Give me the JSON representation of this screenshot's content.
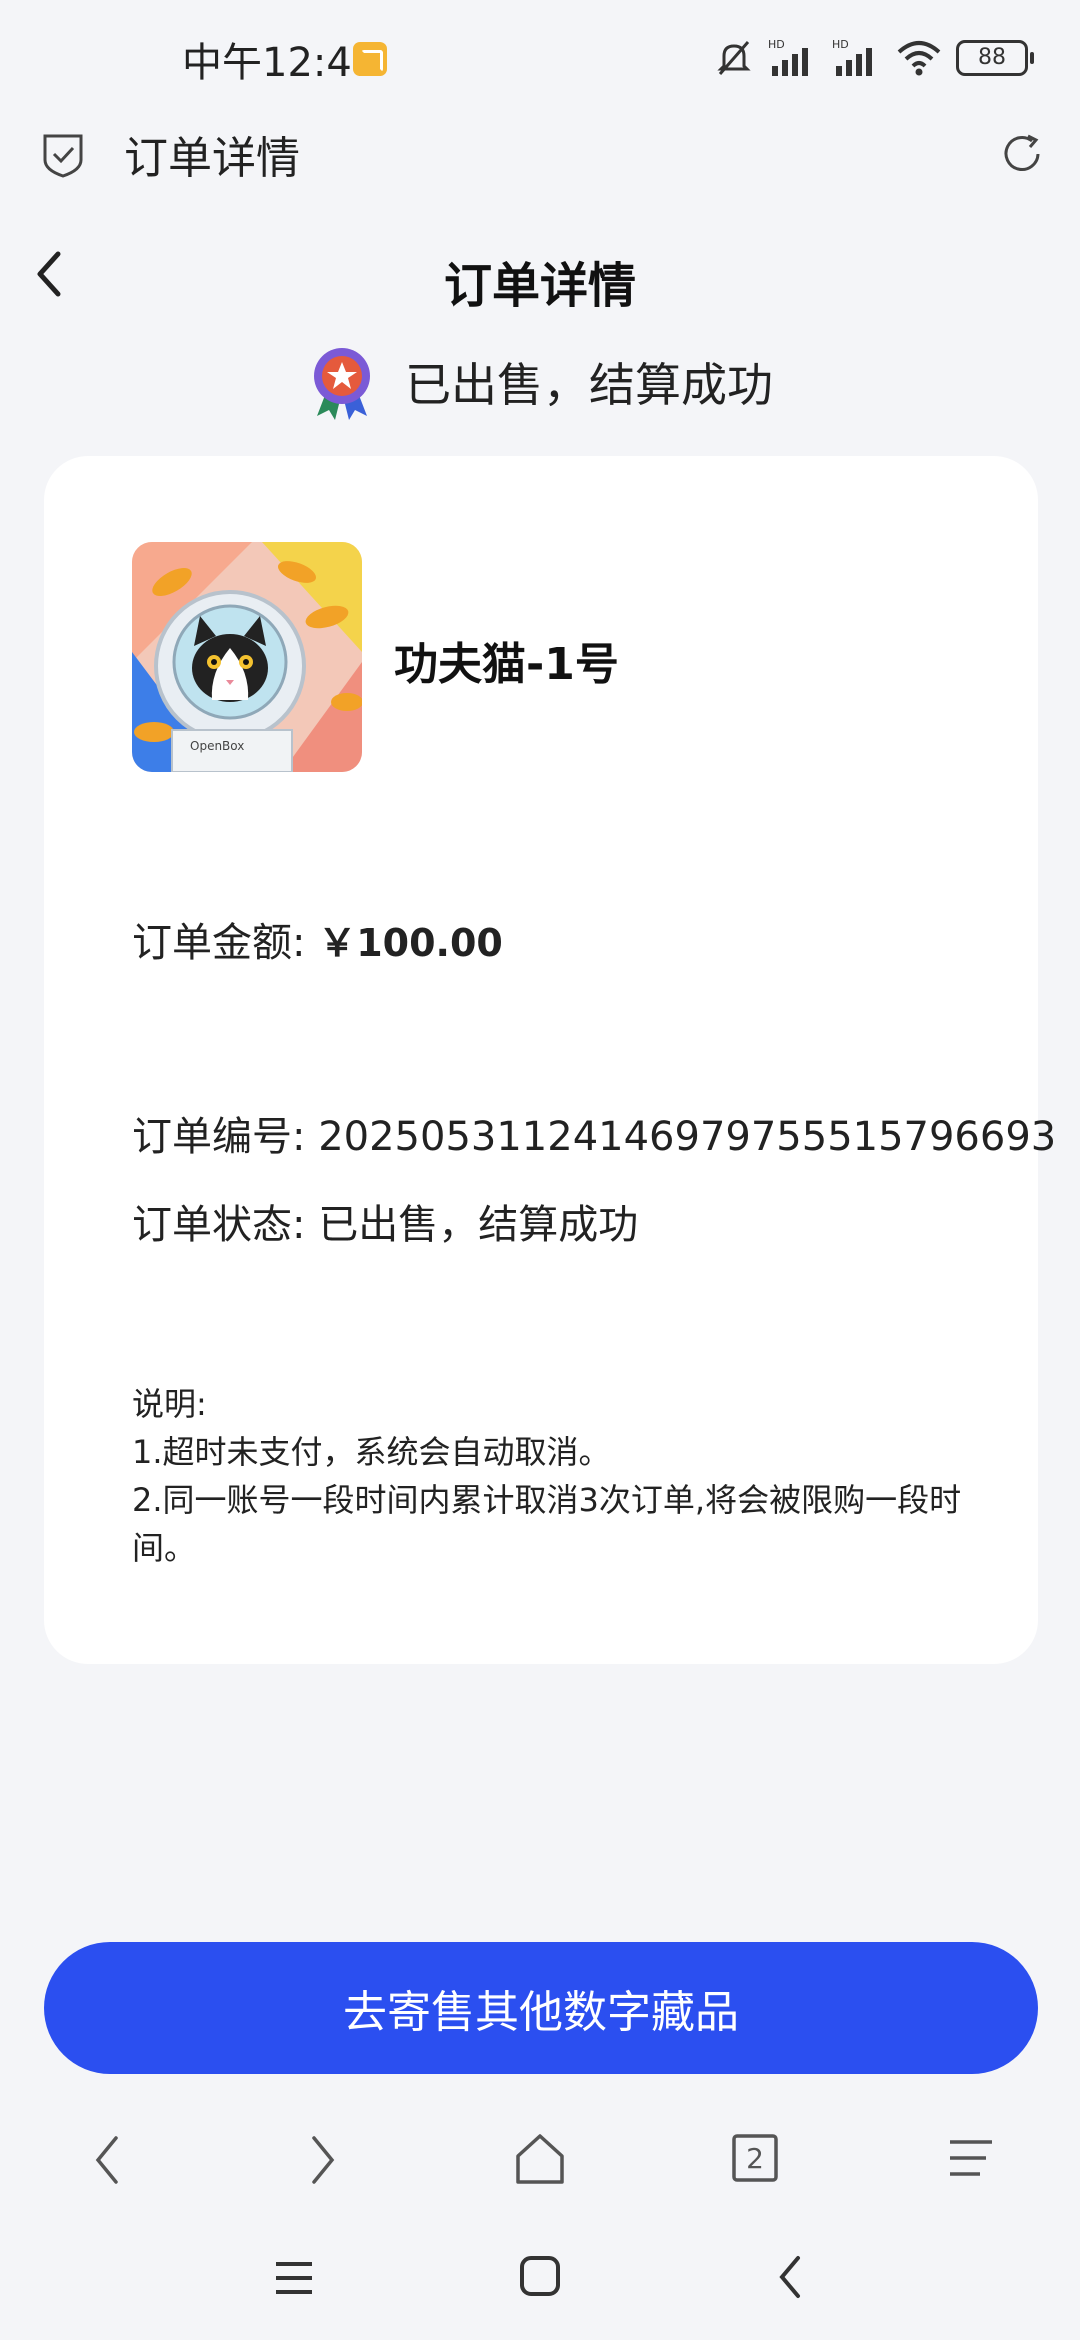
{
  "status_bar": {
    "time": "中午12:47",
    "network_label_1": "HD",
    "network_label_2": "HD",
    "battery": "88"
  },
  "browser": {
    "title": "订单详情"
  },
  "page": {
    "title": "订单详情",
    "status_text": "已出售，结算成功"
  },
  "product": {
    "name": "功夫猫-1号",
    "image_label": "OpenBox"
  },
  "order": {
    "amount_label": "订单金额:",
    "amount_value": "￥100.00",
    "number_label": "订单编号:",
    "number_value": "20250531124146979755515796693",
    "status_label": "订单状态:",
    "status_value": "已出售，结算成功"
  },
  "notes": {
    "title": "说明:",
    "line1": "1.超时未支付，系统会自动取消。",
    "line2": "2.同一账号一段时间内累计取消3次订单,将会被限购一段时间。"
  },
  "action_button": "去寄售其他数字藏品",
  "browser_nav": {
    "tab_count": "2"
  },
  "colors": {
    "accent": "#2b4ff0",
    "background": "#f4f5f8",
    "card": "#ffffff"
  }
}
